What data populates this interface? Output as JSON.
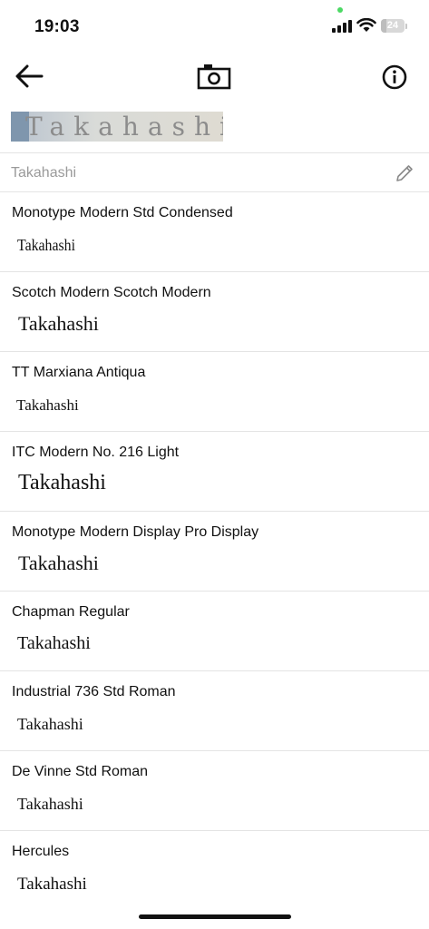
{
  "status_bar": {
    "time": "19:03",
    "battery_level": "24",
    "battery_fraction": 0.24,
    "privacy_dot_color": "#4cd964"
  },
  "toolbar": {
    "back_icon": "arrow-left-icon",
    "camera_icon": "camera-icon",
    "info_icon": "info-circle-icon"
  },
  "sample_image": {
    "text": "Takahashi"
  },
  "search": {
    "value": "Takahashi",
    "edit_icon": "pencil-icon"
  },
  "fonts": [
    {
      "name": "Monotype Modern Std Condensed",
      "sample": "Takahashi"
    },
    {
      "name": "Scotch Modern Scotch Modern",
      "sample": "Takahashi"
    },
    {
      "name": "TT Marxiana Antiqua",
      "sample": "Takahashi"
    },
    {
      "name": "ITC Modern No. 216 Light",
      "sample": "Takahashi"
    },
    {
      "name": "Monotype Modern Display Pro Display",
      "sample": "Takahashi"
    },
    {
      "name": "Chapman Regular",
      "sample": "Takahashi"
    },
    {
      "name": "Industrial 736 Std Roman",
      "sample": "Takahashi"
    },
    {
      "name": "De Vinne Std Roman",
      "sample": "Takahashi"
    },
    {
      "name": "Hercules",
      "sample": "Takahashi"
    }
  ]
}
